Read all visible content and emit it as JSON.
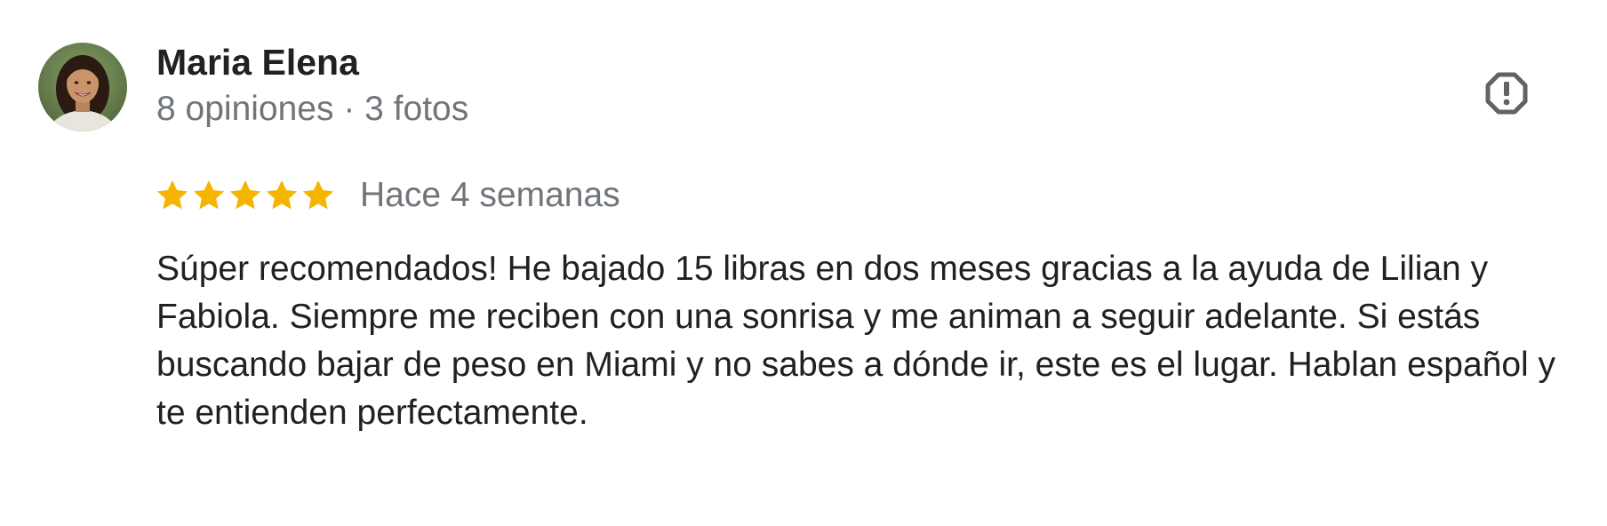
{
  "review": {
    "author_name": "Maria Elena",
    "author_meta": "8 opiniones · 3 fotos",
    "rating": 5,
    "rating_max": 5,
    "date": "Hace 4 semanas",
    "text": "Súper recomendados! He bajado 15 libras en dos meses gracias a la ayuda de Lilian y Fabiola. Siempre me reciben con una sonrisa y me animan a seguir adelante. Si estás buscando bajar de peso en Miami y no sabes a dónde ir, este es el lugar. Hablan español y te entienden perfectamente."
  },
  "icons": {
    "avatar": "user-photo",
    "report": "report-icon",
    "star": "star-icon"
  },
  "colors": {
    "star": "#f4b400",
    "name": "#202124",
    "meta": "#70757a",
    "icon": "#5f6368"
  }
}
